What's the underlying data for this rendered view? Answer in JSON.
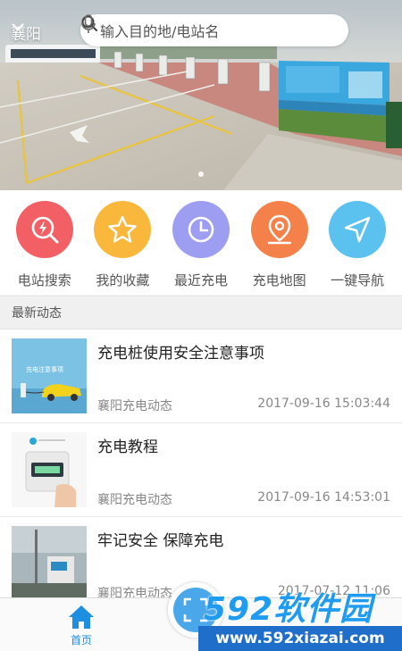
{
  "header": {
    "city": "襄阳",
    "search_placeholder": "输入目的地/电站名"
  },
  "banner": {
    "slide_count": 1,
    "active_slide": 1
  },
  "actions": [
    {
      "label": "电站搜索",
      "icon": "station-search-icon",
      "color": "#f26065"
    },
    {
      "label": "我的收藏",
      "icon": "star-icon",
      "color": "#f9b73c"
    },
    {
      "label": "最近充电",
      "icon": "clock-icon",
      "color": "#9d9ef2"
    },
    {
      "label": "充电地图",
      "icon": "map-pin-icon",
      "color": "#f5814a"
    },
    {
      "label": "一键导航",
      "icon": "navigation-arrow-icon",
      "color": "#5bc1ee"
    }
  ],
  "news": {
    "section_title": "最新动态",
    "items": [
      {
        "title": "充电桩使用安全注意事项",
        "source": "襄阳充电动态",
        "time": "2017-09-16 15:03:44",
        "thumb_caption": "充电注意事项"
      },
      {
        "title": "充电教程",
        "source": "襄阳充电动态",
        "time": "2017-09-16 14:53:01",
        "thumb_caption": ""
      },
      {
        "title": "牢记安全  保障充电",
        "source": "襄阳充电动态",
        "time": "2017-07-12 11:06",
        "thumb_caption": ""
      }
    ]
  },
  "tabbar": {
    "home_label": "首页",
    "accent_color": "#1d8ee0"
  },
  "watermark": {
    "brand": "592软件园",
    "url": "www.592xiazai.com"
  }
}
